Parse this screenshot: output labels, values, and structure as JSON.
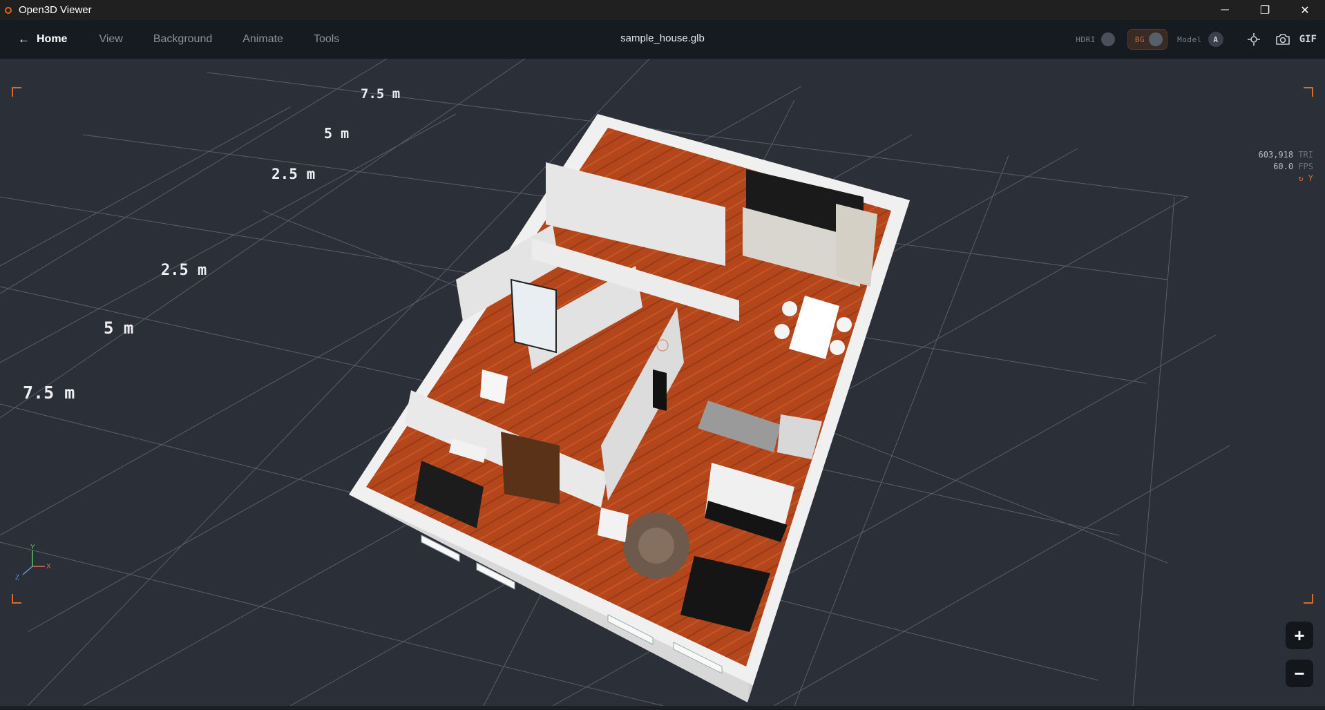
{
  "window": {
    "title": "Open3D Viewer",
    "controls": {
      "minimize": "─",
      "restore": "❐",
      "close": "✕"
    }
  },
  "menubar": {
    "home_label": "Home",
    "items": [
      "View",
      "Background",
      "Animate",
      "Tools"
    ],
    "file_name": "sample_house.glb",
    "hdri_label": "HDRI",
    "bg_label": "BG",
    "model_label": "Model",
    "model_value": "A",
    "gif_label": "GIF",
    "icons": [
      "arrow-left-icon",
      "crosshair-icon",
      "camera-icon"
    ]
  },
  "viewport": {
    "scale_labels": [
      "7.5 m",
      "5 m",
      "2.5 m",
      "2.5 m",
      "5 m",
      "7.5 m"
    ],
    "stats": {
      "triangles": "603,918",
      "triangles_unit": "TRI",
      "fps": "60.0",
      "fps_unit": "FPS",
      "up_axis": "↻ Y"
    },
    "axis_gizmo": {
      "x": "X",
      "y": "Y",
      "z": "Z"
    },
    "zoom_in": "+",
    "zoom_out": "−"
  },
  "colors": {
    "accent": "#d76c2e",
    "background": "#2b2f38",
    "grid": "#5d6472",
    "floor_wood": "#b4461c",
    "walls": "#e3e3e3"
  }
}
